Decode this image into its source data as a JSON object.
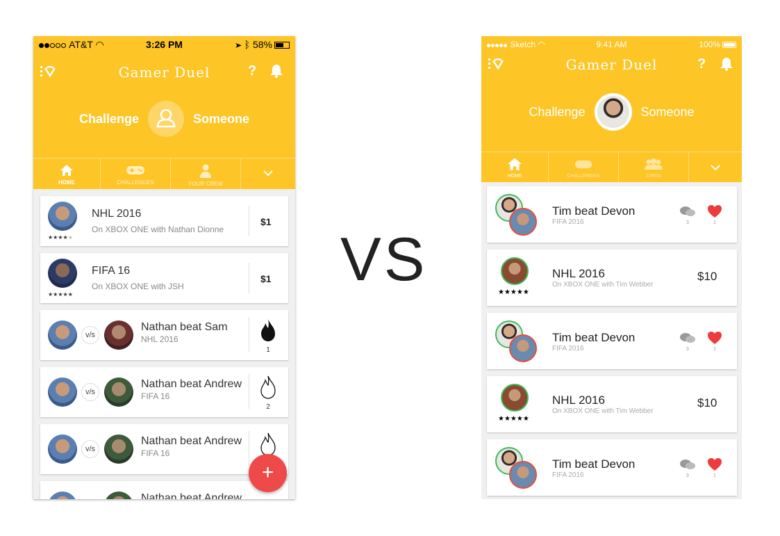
{
  "colors": {
    "brand_yellow": "#fdc526",
    "fab_red": "#ef4a4a",
    "win_green": "#3dbb5a",
    "lose_red": "#e84c3d",
    "heart_red": "#ee3b3b"
  },
  "vs_label": "VS",
  "left": {
    "status": {
      "carrier": "AT&T",
      "time": "3:26 PM",
      "battery": "58%"
    },
    "app_title": "Gamer Duel",
    "help": "?",
    "challenge": {
      "left": "Challenge",
      "right": "Someone"
    },
    "tabs": [
      "HOME",
      "CHALLENGES",
      "YOUR CREW"
    ],
    "cards": [
      {
        "title": "NHL 2016",
        "subtitle": "On XBOX ONE with Nathan Dionne",
        "stars": "★★★★",
        "star_off": "★",
        "amount": "$1"
      },
      {
        "title": "FIFA 16",
        "subtitle": "On XBOX ONE with JSH",
        "stars": "★★★★★",
        "amount": "$1"
      },
      {
        "title": "Nathan beat Sam",
        "subtitle": "NHL 2016",
        "vs": "v/s",
        "count": "1"
      },
      {
        "title": "Nathan beat Andrew",
        "subtitle": "FIFA 16",
        "vs": "v/s",
        "count": "2"
      },
      {
        "title": "Nathan beat Andrew",
        "subtitle": "FIFA 16",
        "vs": "v/s"
      },
      {
        "title": "Nathan beat Andrew"
      }
    ],
    "fab": "+"
  },
  "right": {
    "status": {
      "carrier": "Sketch",
      "time": "9:41 AM",
      "battery": "100%"
    },
    "app_title": "Gamer Duel",
    "help": "?",
    "challenge": {
      "left": "Challenge",
      "right": "Someone"
    },
    "tabs": [
      "HOME",
      "CHALLENGES",
      "CREW"
    ],
    "cards": [
      {
        "title": "Tim beat Devon",
        "subtitle": "FIFA 2016",
        "comments": "3",
        "likes": "1"
      },
      {
        "title": "NHL 2016",
        "subtitle": "On XBOX ONE with Tim Webber",
        "stars": "★★★★★",
        "amount": "$10"
      },
      {
        "title": "Tim beat Devon",
        "subtitle": "FIFA 2016",
        "comments": "3",
        "likes": "1"
      },
      {
        "title": "NHL 2016",
        "subtitle": "On XBOX ONE with Tim Webber",
        "stars": "★★★★★",
        "amount": "$10"
      },
      {
        "title": "Tim beat Devon",
        "subtitle": "FIFA 2016",
        "comments": "3",
        "likes": "1"
      }
    ]
  }
}
